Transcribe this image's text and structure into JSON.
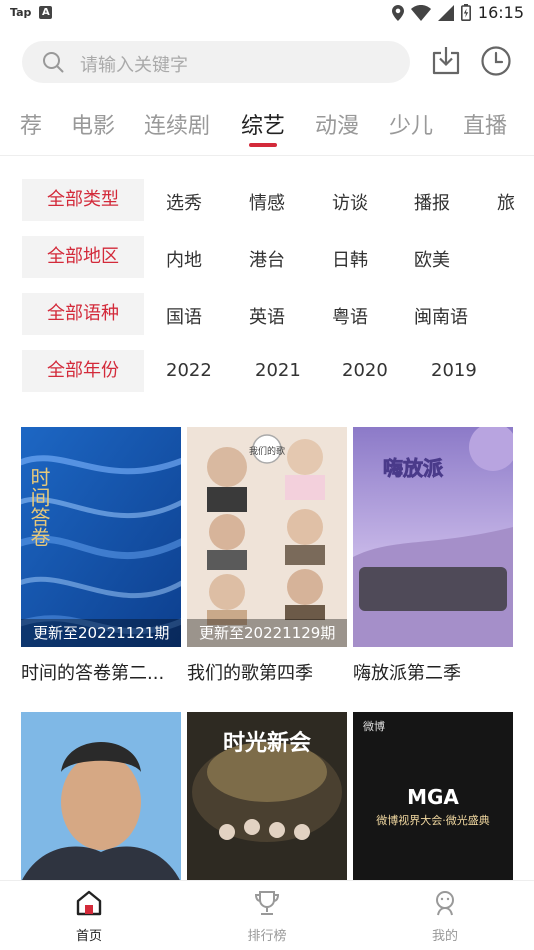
{
  "status": {
    "app_tag": "Tap",
    "a_icon": "A",
    "time": "16:15"
  },
  "search": {
    "placeholder": "请输入关键字"
  },
  "tabs": [
    {
      "label": "荐",
      "active": false
    },
    {
      "label": "电影",
      "active": false
    },
    {
      "label": "连续剧",
      "active": false
    },
    {
      "label": "综艺",
      "active": true
    },
    {
      "label": "动漫",
      "active": false
    },
    {
      "label": "少儿",
      "active": false
    },
    {
      "label": "直播",
      "active": false
    }
  ],
  "filters": [
    {
      "button": "全部类型",
      "options": [
        "选秀",
        "情感",
        "访谈",
        "播报",
        "旅"
      ]
    },
    {
      "button": "全部地区",
      "options": [
        "内地",
        "港台",
        "日韩",
        "欧美"
      ]
    },
    {
      "button": "全部语种",
      "options": [
        "国语",
        "英语",
        "粤语",
        "闽南语"
      ]
    },
    {
      "button": "全部年份",
      "options": [
        "2022",
        "2021",
        "2020",
        "2019"
      ]
    }
  ],
  "cards": [
    {
      "title": "时间的答卷第二季",
      "title_display": "时间的答卷第二...",
      "badge": "更新至20221121期",
      "poster_text": "时间答卷"
    },
    {
      "title": "我们的歌第四季",
      "title_display": "我们的歌第四季",
      "badge": "更新至20221129期",
      "poster_text": "我们的歌"
    },
    {
      "title": "嗨放派第二季",
      "title_display": "嗨放派第二季",
      "badge": "",
      "poster_text": "嗨放派"
    },
    {
      "title": "",
      "title_display": "",
      "badge": "",
      "poster_text": ""
    },
    {
      "title": "",
      "title_display": "",
      "badge": "",
      "poster_text": "时光新会"
    },
    {
      "title": "",
      "title_display": "",
      "badge": "",
      "poster_text": "微博视界大会·微光盛典"
    }
  ],
  "poster_extras": {
    "weibo": "微博",
    "mga": "MGA"
  },
  "bottom_nav": [
    {
      "label": "首页",
      "icon": "home-icon",
      "active": true
    },
    {
      "label": "排行榜",
      "icon": "trophy-icon",
      "active": false
    },
    {
      "label": "我的",
      "icon": "profile-icon",
      "active": false
    }
  ],
  "colors": {
    "accent": "#d32a3a",
    "filter_bg": "#f3f3f3",
    "search_bg": "#f1f1f1"
  }
}
